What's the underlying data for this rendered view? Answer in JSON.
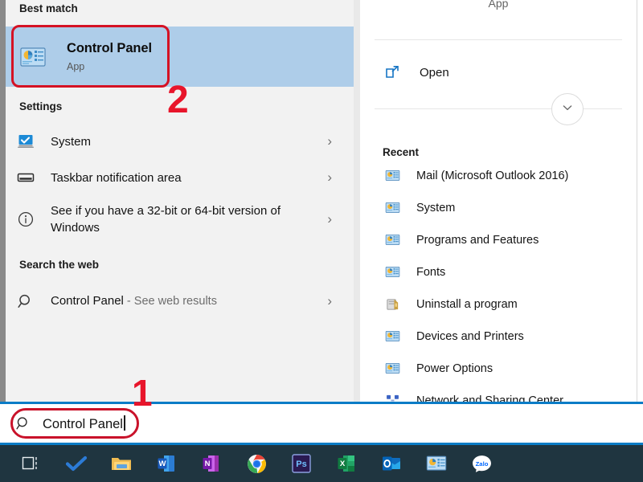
{
  "left_panel": {
    "best_match_heading": "Best match",
    "best_match": {
      "title": "Control Panel",
      "subtitle": "App",
      "icon": "control-panel-icon"
    },
    "settings_heading": "Settings",
    "settings_items": [
      {
        "label": "System",
        "icon": "monitor-check-icon",
        "chevron": "›"
      },
      {
        "label": "Taskbar notification area",
        "icon": "taskbar-icon",
        "chevron": "›"
      },
      {
        "label": "See if you have a 32-bit or 64-bit version of Windows",
        "icon": "info-circle-icon",
        "chevron": "›"
      }
    ],
    "web_heading": "Search the web",
    "web_item": {
      "query": "Control Panel",
      "suffix": " - See web results",
      "icon": "search-icon",
      "chevron": "›"
    }
  },
  "right_panel": {
    "app_type": "App",
    "open_label": "Open",
    "open_icon": "open-external-icon",
    "expand_icon": "chevron-down-icon",
    "recent_heading": "Recent",
    "recent_items": [
      {
        "label": "Mail (Microsoft Outlook 2016)",
        "icon": "control-panel-icon"
      },
      {
        "label": "System",
        "icon": "control-panel-icon"
      },
      {
        "label": "Programs and Features",
        "icon": "control-panel-icon"
      },
      {
        "label": "Fonts",
        "icon": "control-panel-icon"
      },
      {
        "label": "Uninstall a program",
        "icon": "uninstall-program-icon"
      },
      {
        "label": "Devices and Printers",
        "icon": "control-panel-icon"
      },
      {
        "label": "Power Options",
        "icon": "control-panel-icon"
      },
      {
        "label": "Network and Sharing Center",
        "icon": "network-sharing-icon"
      }
    ]
  },
  "search_bar": {
    "value": "Control Panel",
    "icon": "search-icon",
    "border_color": "#0a7cc6"
  },
  "taskbar": {
    "background": "#1f3540",
    "items": [
      {
        "name": "task-view-icon",
        "label": "Task View"
      },
      {
        "name": "microsoft-todo-icon",
        "label": "Microsoft To Do"
      },
      {
        "name": "file-explorer-icon",
        "label": "File Explorer"
      },
      {
        "name": "word-icon",
        "label": "Word"
      },
      {
        "name": "onenote-icon",
        "label": "OneNote"
      },
      {
        "name": "chrome-icon",
        "label": "Google Chrome"
      },
      {
        "name": "photoshop-icon",
        "label": "Adobe Photoshop"
      },
      {
        "name": "excel-icon",
        "label": "Excel"
      },
      {
        "name": "outlook-icon",
        "label": "Outlook"
      },
      {
        "name": "control-panel-icon",
        "label": "Control Panel"
      },
      {
        "name": "zalo-icon",
        "label": "Zalo"
      }
    ]
  },
  "annotations": [
    {
      "number": "1",
      "target": "search-input"
    },
    {
      "number": "2",
      "target": "best-match-control-panel"
    }
  ],
  "colors": {
    "highlight": "#aecde9",
    "annotation_red": "#d51224",
    "accent_blue": "#0a7cc6",
    "left_bg": "#f2f2f2"
  }
}
